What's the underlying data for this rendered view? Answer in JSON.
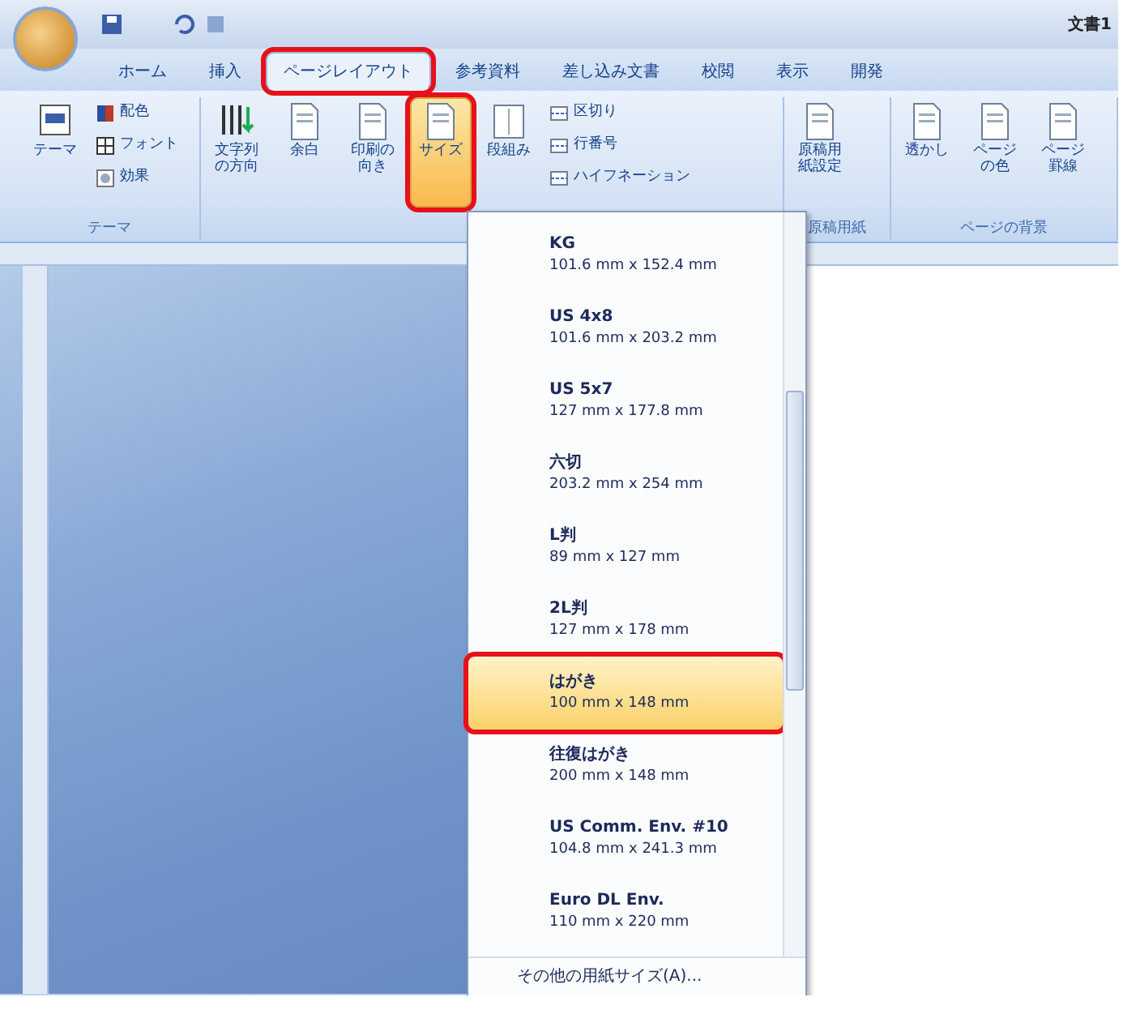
{
  "window": {
    "title": "文書1"
  },
  "tabs": [
    {
      "label": "ホーム",
      "selected": false,
      "highlighted": false
    },
    {
      "label": "挿入",
      "selected": false,
      "highlighted": false
    },
    {
      "label": "ページレイアウト",
      "selected": true,
      "highlighted": true
    },
    {
      "label": "参考資料",
      "selected": false,
      "highlighted": false
    },
    {
      "label": "差し込み文書",
      "selected": false,
      "highlighted": false
    },
    {
      "label": "校閲",
      "selected": false,
      "highlighted": false
    },
    {
      "label": "表示",
      "selected": false,
      "highlighted": false
    },
    {
      "label": "開発",
      "selected": false,
      "highlighted": false
    }
  ],
  "ribbon_groups": [
    {
      "label": "テーマ",
      "buttons": [
        {
          "kind": "large",
          "label": "テーマ",
          "selected": false,
          "highlighted": false
        },
        {
          "kind": "small",
          "label": "配色",
          "selected": false,
          "highlighted": false
        },
        {
          "kind": "small",
          "label": "フォント",
          "selected": false,
          "highlighted": false
        },
        {
          "kind": "small",
          "label": "効果",
          "selected": false,
          "highlighted": false
        }
      ]
    },
    {
      "buttons": [
        {
          "kind": "large",
          "label": "文字列の方向",
          "selected": false,
          "highlighted": false
        },
        {
          "kind": "large",
          "label": "余白",
          "selected": false,
          "highlighted": false
        },
        {
          "kind": "large",
          "label": "印刷の向き",
          "selected": false,
          "highlighted": false
        },
        {
          "kind": "large",
          "label": "サイズ",
          "selected": true,
          "highlighted": true
        },
        {
          "kind": "large",
          "label": "段組み",
          "selected": false,
          "highlighted": false
        },
        {
          "kind": "small",
          "label": "区切り",
          "selected": false,
          "highlighted": false
        },
        {
          "kind": "small",
          "label": "行番号",
          "selected": false,
          "highlighted": false
        },
        {
          "kind": "small",
          "label": "ハイフネーション",
          "selected": false,
          "highlighted": false
        }
      ]
    },
    {
      "label": "原稿用紙",
      "buttons": [
        {
          "kind": "large",
          "label": "原稿用紙設定",
          "selected": false,
          "highlighted": false
        }
      ]
    },
    {
      "label": "ページの背景",
      "buttons": [
        {
          "kind": "large",
          "label": "透かし",
          "selected": false,
          "highlighted": false
        },
        {
          "kind": "large",
          "label": "ページの色",
          "selected": false,
          "highlighted": false
        },
        {
          "kind": "large",
          "label": "ページ罫線",
          "selected": false,
          "highlighted": false
        }
      ]
    }
  ],
  "size_menu": {
    "items": [
      {
        "name": "KG",
        "size": "101.6 mm x 152.4 mm",
        "selected": false,
        "highlighted": false
      },
      {
        "name": "US 4x8",
        "size": "101.6 mm x 203.2 mm",
        "selected": false,
        "highlighted": false
      },
      {
        "name": "US 5x7",
        "size": "127 mm x 177.8 mm",
        "selected": false,
        "highlighted": false
      },
      {
        "name": "六切",
        "size": "203.2 mm x 254 mm",
        "selected": false,
        "highlighted": false
      },
      {
        "name": "L判",
        "size": "89 mm x 127 mm",
        "selected": false,
        "highlighted": false
      },
      {
        "name": "2L判",
        "size": "127 mm x 178 mm",
        "selected": false,
        "highlighted": false
      },
      {
        "name": "はがき",
        "size": "100 mm x 148 mm",
        "selected": true,
        "highlighted": true
      },
      {
        "name": "往復はがき",
        "size": "200 mm x 148 mm",
        "selected": false,
        "highlighted": false
      },
      {
        "name": "US Comm. Env. #10",
        "size": "104.8 mm x 241.3 mm",
        "selected": false,
        "highlighted": false
      },
      {
        "name": "Euro DL Env.",
        "size": "110 mm x 220 mm",
        "selected": false,
        "highlighted": false
      }
    ],
    "footer": "その他の用紙サイズ(A)..."
  }
}
